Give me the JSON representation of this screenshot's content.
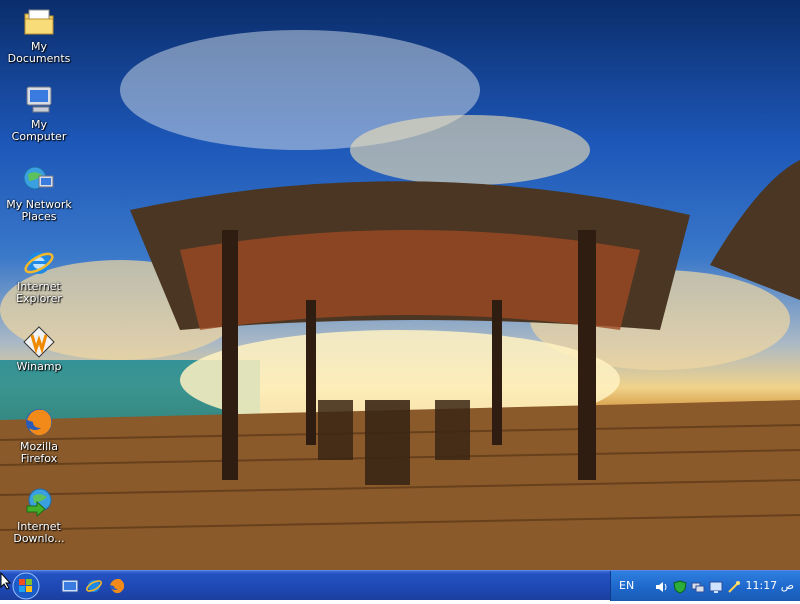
{
  "desktop": {
    "icons": [
      {
        "label": "My Documents",
        "icon": "folder-documents-icon"
      },
      {
        "label": "My Computer",
        "icon": "computer-icon"
      },
      {
        "label": "My Network Places",
        "icon": "network-places-icon"
      },
      {
        "label": "Internet Explorer",
        "icon": "internet-explorer-icon"
      },
      {
        "label": "Winamp",
        "icon": "winamp-icon"
      },
      {
        "label": "Mozilla Firefox",
        "icon": "firefox-icon"
      },
      {
        "label": "Internet Downlo...",
        "icon": "internet-download-manager-icon"
      }
    ]
  },
  "taskbar": {
    "start_icon": "start-orb-icon",
    "quick_launch": [
      {
        "icon": "show-desktop-icon"
      },
      {
        "icon": "internet-explorer-icon"
      },
      {
        "icon": "firefox-icon"
      }
    ],
    "tray": {
      "language": "EN",
      "icons": [
        "volume-icon",
        "security-shield-icon",
        "network-icon",
        "display-icon",
        "wand-icon"
      ],
      "clock": "11:17 ص"
    }
  },
  "colors": {
    "taskbar": "#1e48b3",
    "tray": "#1d66c9",
    "label_text": "#ffffff"
  }
}
